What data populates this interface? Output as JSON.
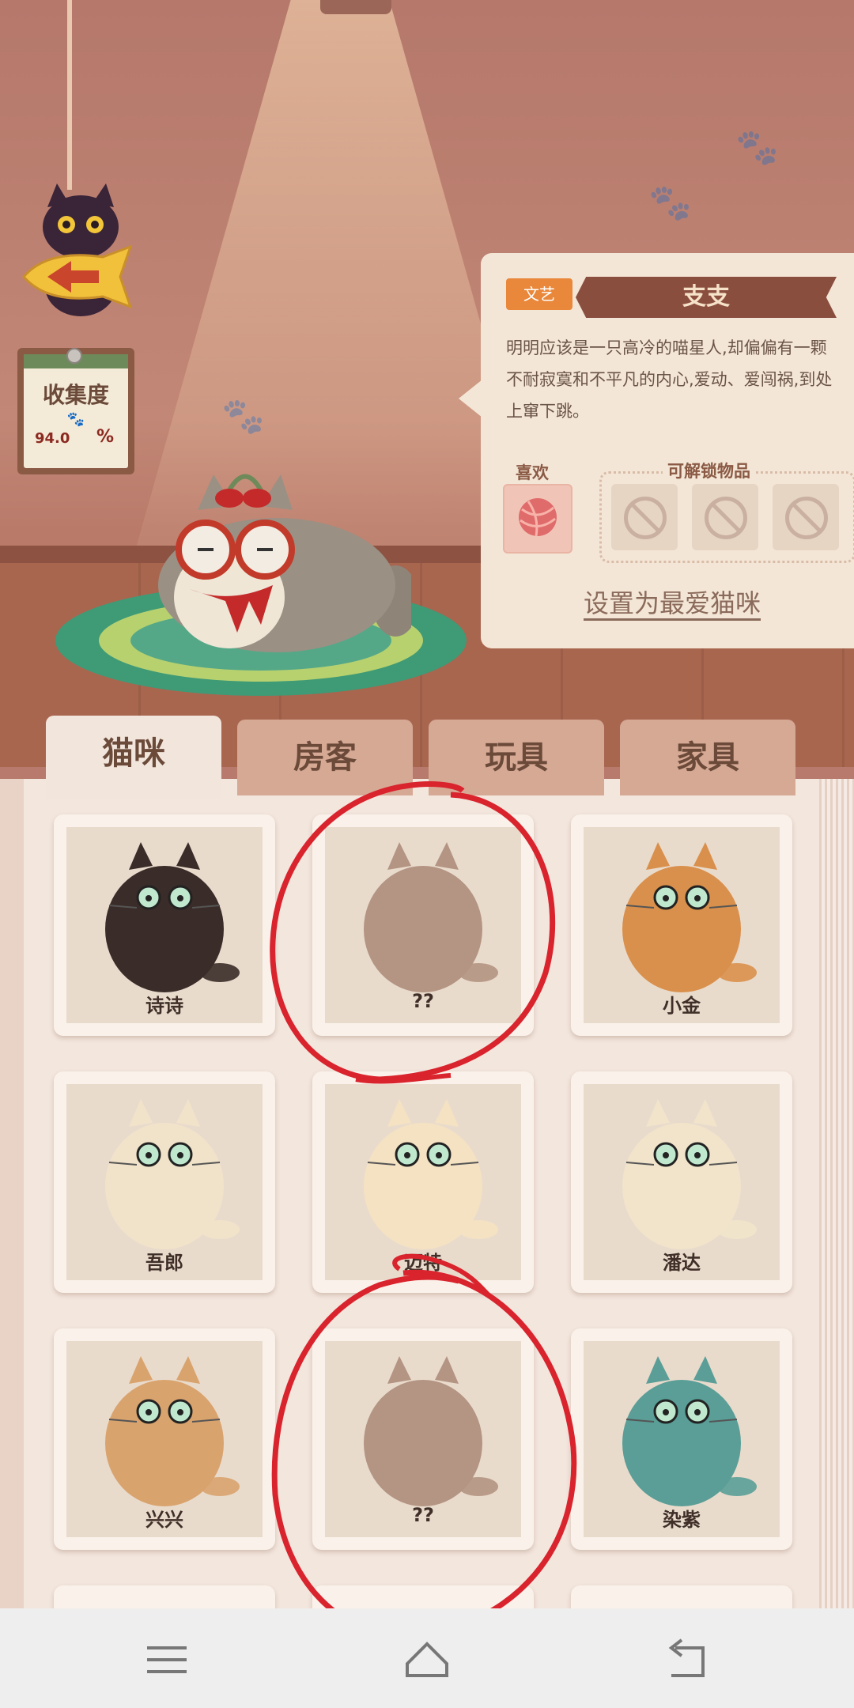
{
  "collection": {
    "title": "收集度",
    "value": "94.0",
    "unit": "%"
  },
  "cat_info": {
    "tag": "文艺",
    "name": "支支",
    "description": "明明应该是一只高冷的喵星人,却偏偏有一颗不耐寂寞和不平凡的内心,爱动、爱闯祸,到处上窜下跳。",
    "like_label": "喜欢",
    "unlock_label": "可解锁物品",
    "favorite_button": "设置为最爱猫咪"
  },
  "tabs": [
    {
      "label": "猫咪",
      "active": true
    },
    {
      "label": "房客",
      "active": false
    },
    {
      "label": "玩具",
      "active": false
    },
    {
      "label": "家具",
      "active": false
    }
  ],
  "cats": [
    {
      "name": "诗诗",
      "color": "#3a2c28"
    },
    {
      "name": "??",
      "color": "#b49482"
    },
    {
      "name": "小金",
      "color": "#d9904c"
    },
    {
      "name": "吾郎",
      "color": "#f1e3c9"
    },
    {
      "name": "迈特",
      "color": "#f5e2c2"
    },
    {
      "name": "潘达",
      "color": "#f1e4ca"
    },
    {
      "name": "兴兴",
      "color": "#d9a36e"
    },
    {
      "name": "??",
      "color": "#b49482"
    },
    {
      "name": "染紫",
      "color": "#5a9e97"
    }
  ],
  "colors": {
    "annotation": "#d9232d"
  }
}
